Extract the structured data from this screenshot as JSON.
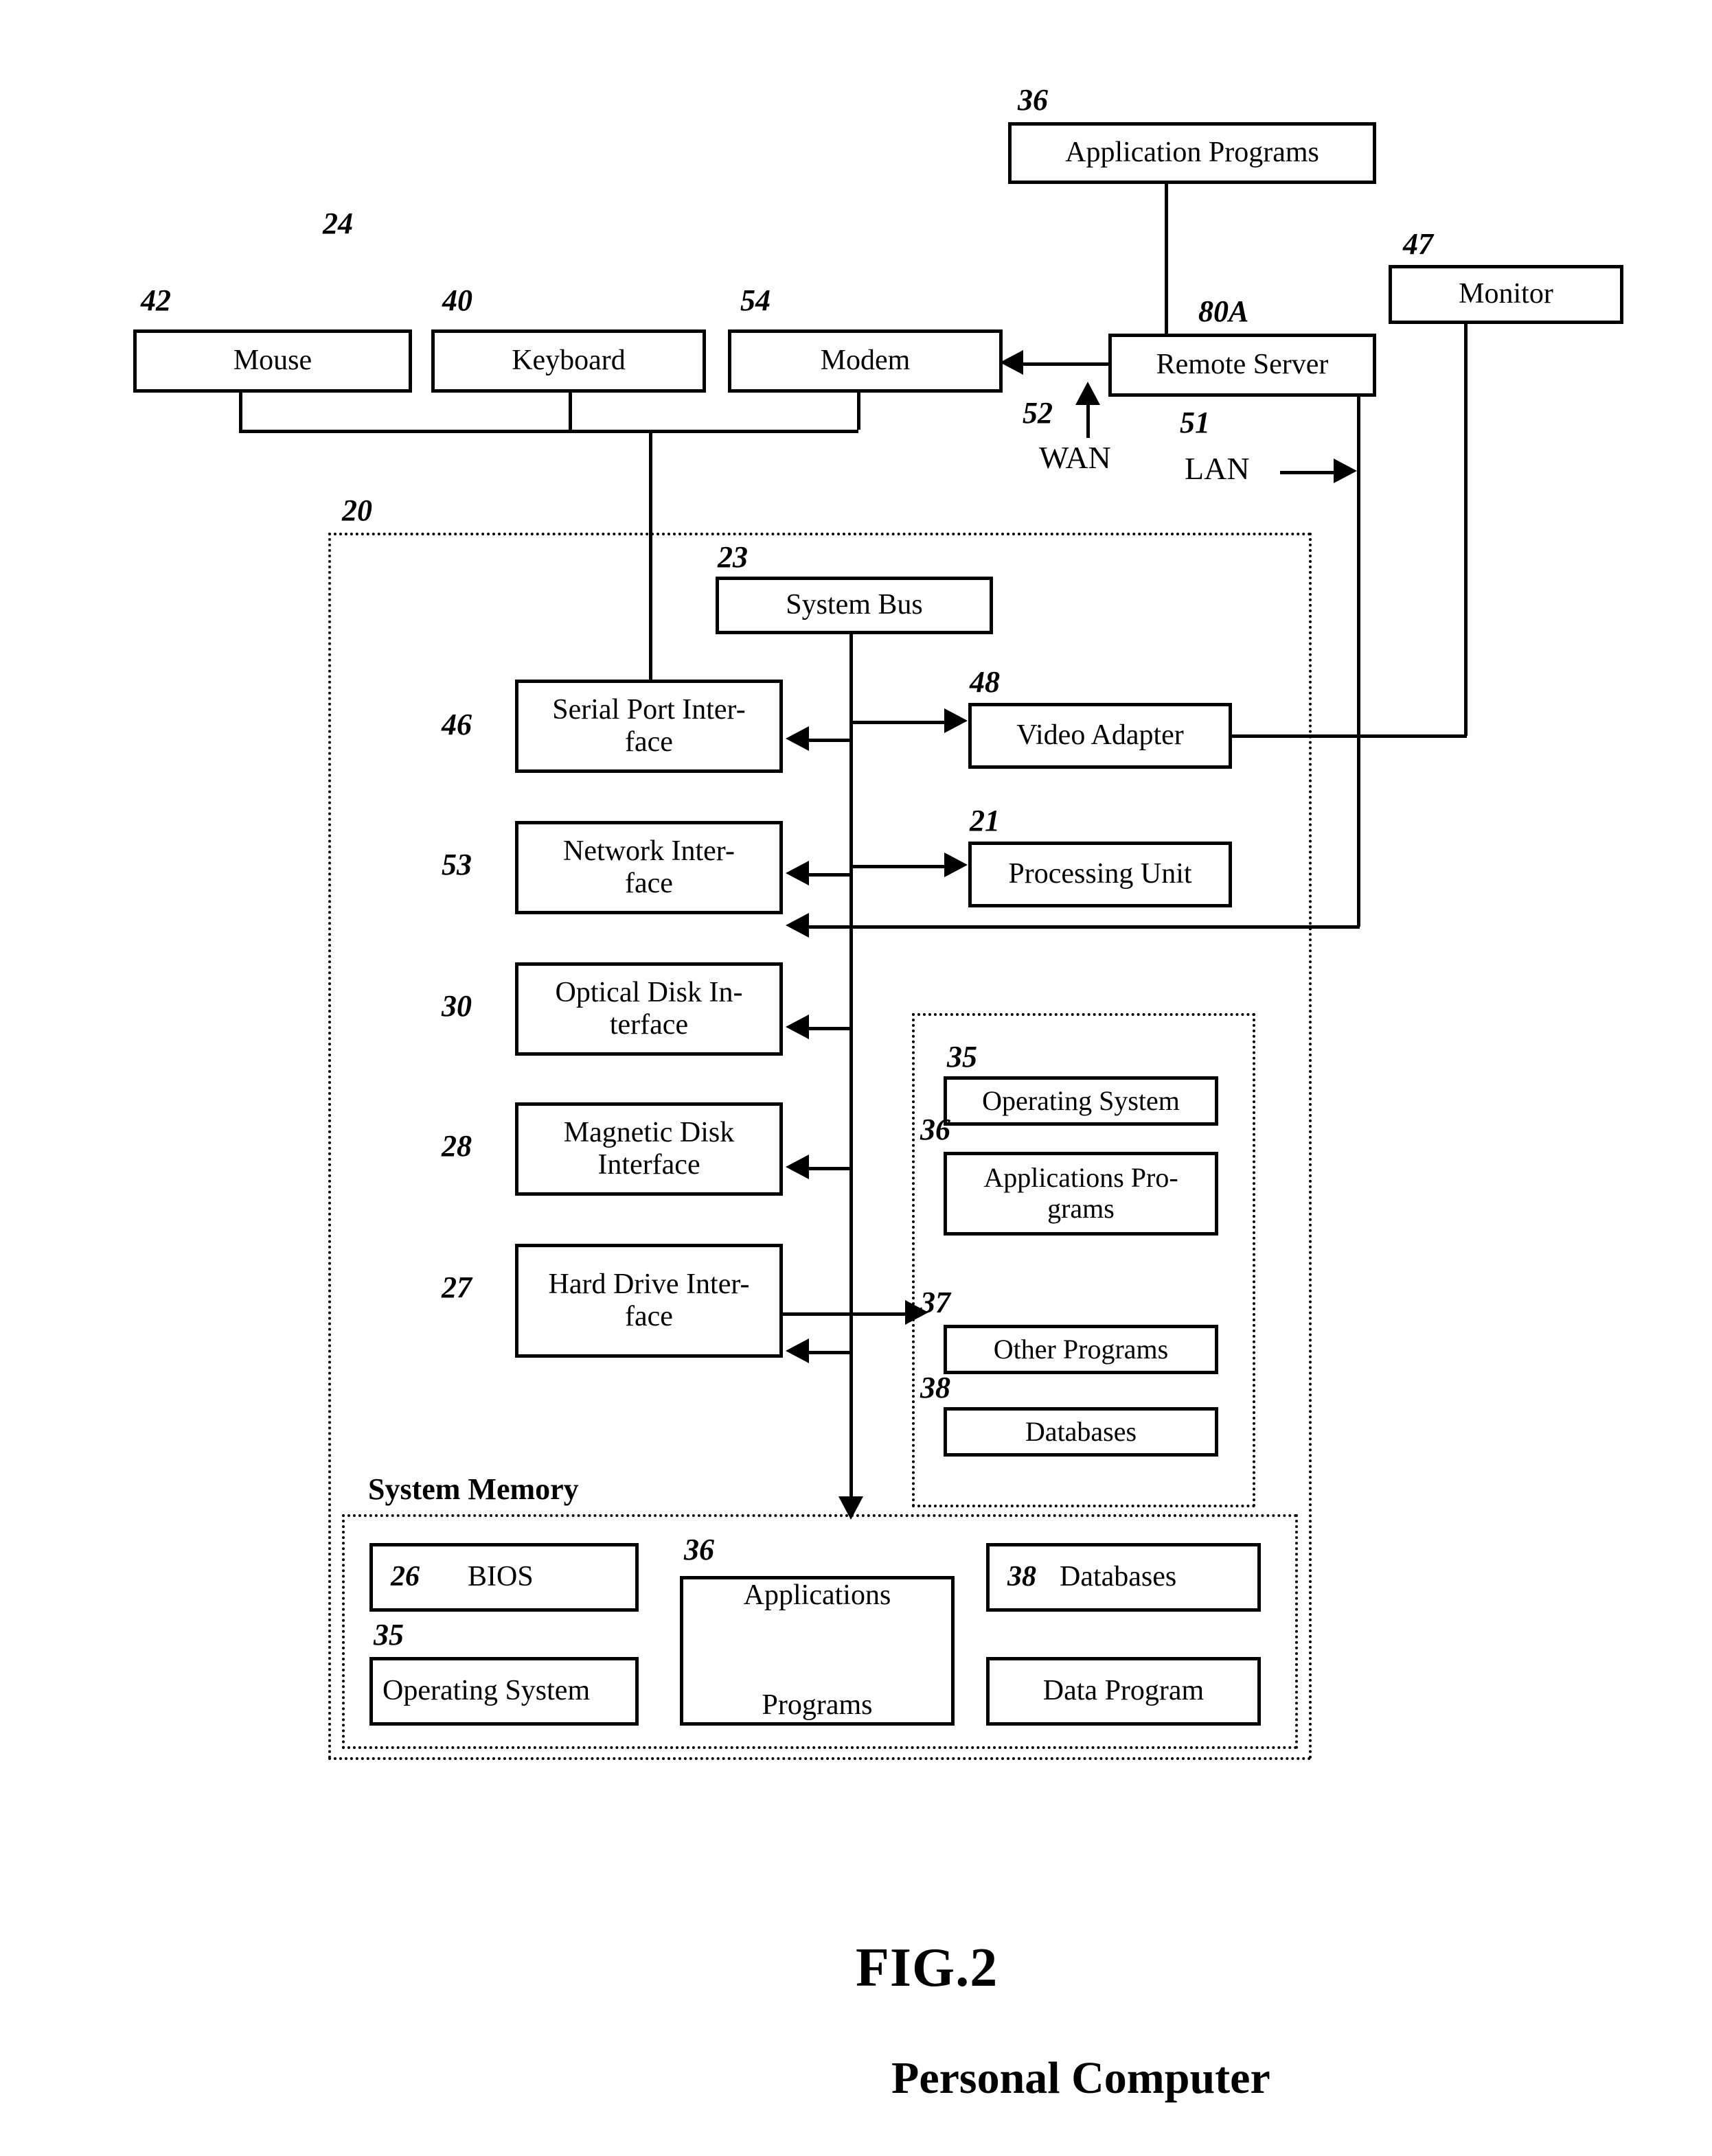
{
  "figure": {
    "title": "FIG.2",
    "subtitle": "Personal Computer"
  },
  "nodes": {
    "application_programs": {
      "label": "Application Programs",
      "ref": "36"
    },
    "monitor": {
      "label": "Monitor",
      "ref": "47"
    },
    "remote_server": {
      "label": "Remote Server",
      "ref": "80A"
    },
    "mouse": {
      "label": "Mouse",
      "ref": "42"
    },
    "keyboard": {
      "label": "Keyboard",
      "ref": "40"
    },
    "modem": {
      "label": "Modem",
      "ref": "54"
    },
    "system_bus": {
      "label": "System Bus",
      "ref": "23"
    },
    "video_adapter": {
      "label": "Video Adapter",
      "ref": "48"
    },
    "processing_unit": {
      "label": "Processing Unit",
      "ref": "21"
    },
    "serial_port_interface": {
      "label": "Serial Port Inter-\nface",
      "ref": "46"
    },
    "network_interface": {
      "label": "Network Inter-\nface",
      "ref": "53"
    },
    "optical_disk_interface": {
      "label": "Optical Disk In-\nterface",
      "ref": "30"
    },
    "magnetic_disk_interface": {
      "label": "Magnetic Disk\nInterface",
      "ref": "28"
    },
    "hard_drive_interface": {
      "label": "Hard Drive Inter-\nface",
      "ref": "27"
    }
  },
  "computer": {
    "ref": "24",
    "enclosure_ref": "20"
  },
  "network_labels": {
    "wan": {
      "text": "WAN",
      "ref": "52"
    },
    "lan": {
      "text": "LAN",
      "ref": "51"
    }
  },
  "storage_group": {
    "items": [
      {
        "label": "Operating System",
        "ref": "35"
      },
      {
        "label": "Applications Pro-\ngrams",
        "ref": "36"
      },
      {
        "label": "Other Programs",
        "ref": "37"
      },
      {
        "label": "Databases",
        "ref": "38"
      }
    ]
  },
  "system_memory": {
    "title": "System Memory",
    "items": [
      {
        "label": "BIOS",
        "ref": "26"
      },
      {
        "label": "Operating System",
        "ref": "35"
      },
      {
        "label": "Applications\n\nPrograms",
        "ref": "36"
      },
      {
        "label": "Databases",
        "ref": "38"
      },
      {
        "label": "Data Program",
        "ref": ""
      }
    ]
  },
  "colors": {
    "ink": "#000000",
    "paper": "#ffffff"
  }
}
